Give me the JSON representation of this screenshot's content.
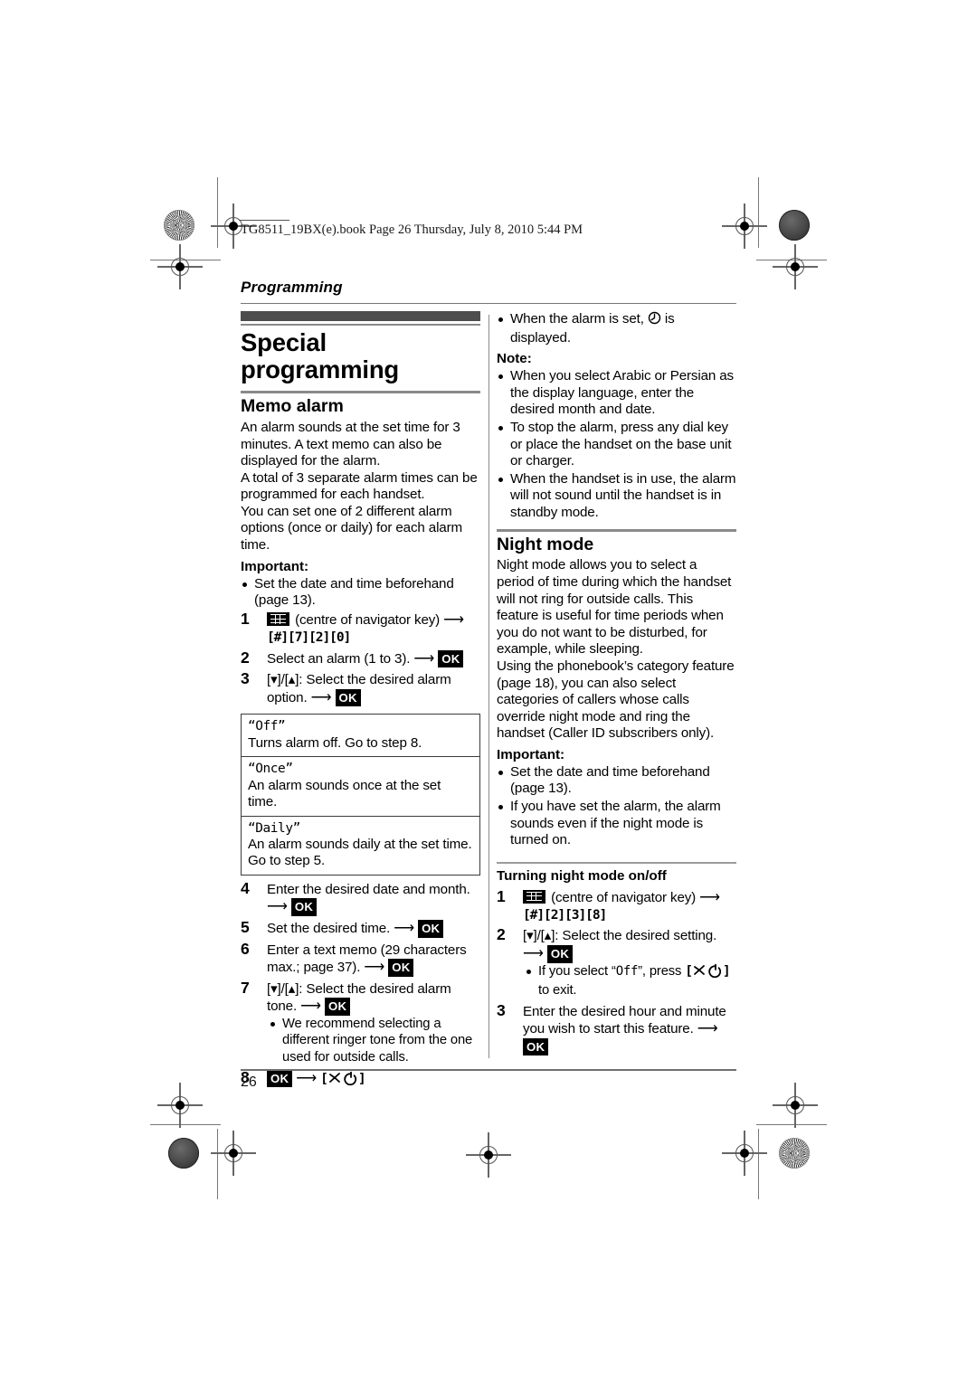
{
  "header": {
    "book_line": "TG8511_19BX(e).book  Page 26  Thursday, July 8, 2010  5:44 PM",
    "chapter": "Programming"
  },
  "footer": {
    "page_number": "26"
  },
  "left_column": {
    "title": "Special programming",
    "section": {
      "heading": "Memo alarm",
      "paragraphs": [
        "An alarm sounds at the set time for 3 minutes. A text memo can also be displayed for the alarm.",
        "A total of 3 separate alarm times can be programmed for each handset.",
        "You can set one of 2 different alarm options (once or daily) for each alarm time."
      ],
      "important_label": "Important:",
      "important_bullets": [
        "Set the date and time beforehand (page 13)."
      ],
      "steps": [
        {
          "num": "1",
          "pre": "",
          "icon": "navigator-key-icon",
          "text": "(centre of navigator key)",
          "arrow": "⟶",
          "keys": "[#][7][2][0]"
        },
        {
          "num": "2",
          "text": "Select an alarm (1 to 3).",
          "arrow": "⟶",
          "ok": "OK"
        },
        {
          "num": "3",
          "text": "[▾]/[▴]: Select the desired alarm option.",
          "arrow": "⟶",
          "ok": "OK"
        }
      ],
      "options_table": [
        {
          "name": "“Off”",
          "desc": "Turns alarm off. Go to step 8."
        },
        {
          "name": "“Once”",
          "desc": "An alarm sounds once at the set time."
        },
        {
          "name": "“Daily”",
          "desc": "An alarm sounds daily at the set time. Go to step 5."
        }
      ],
      "steps2": [
        {
          "num": "4",
          "text": "Enter the desired date and month.",
          "arrow": "⟶",
          "ok": "OK"
        },
        {
          "num": "5",
          "text": "Set the desired time.",
          "arrow": "⟶",
          "ok": "OK"
        },
        {
          "num": "6",
          "text": "Enter a text memo (29 characters max.; page 37).",
          "arrow": "⟶",
          "ok": "OK"
        },
        {
          "num": "7",
          "text": "[▾]/[▴]: Select the desired alarm tone.",
          "arrow": "⟶",
          "ok": "OK"
        },
        {
          "num": "8",
          "ok": "OK",
          "arrow": "⟶",
          "text_after": "[phone-off]"
        }
      ],
      "step7_bullet": "We recommend selecting a different ringer tone from the one used for outside calls."
    }
  },
  "right_column": {
    "top_bullets": [
      "When the alarm is set, Ⓔ is displayed."
    ],
    "note_label": "Note:",
    "note_bullets": [
      "When you select Arabic or Persian as the display language, enter the desired month and date.",
      "To stop the alarm, press any dial key or place the handset on the base unit or charger.",
      "When the handset is in use, the alarm will not sound until the handset is in standby mode."
    ],
    "section": {
      "heading": "Night mode",
      "paragraphs": [
        "Night mode allows you to select a period of time during which the handset will not ring for outside calls. This feature is useful for time periods when you do not want to be disturbed, for example, while sleeping.",
        "Using the phonebook’s category feature (page 18), you can also select categories of callers whose calls override night mode and ring the handset (Caller ID subscribers only)."
      ],
      "important_label": "Important:",
      "important_bullets": [
        "Set the date and time beforehand (page 13).",
        "If you have set the alarm, the alarm sounds even if the night mode is turned on."
      ],
      "subsection_heading": "Turning night mode on/off",
      "steps": [
        {
          "num": "1",
          "icon": "navigator-key-icon",
          "text": "(centre of navigator key)",
          "arrow": "⟶",
          "keys": "[#][2][3][8]"
        },
        {
          "num": "2",
          "text": "[▾]/[▴]: Select the desired setting.",
          "arrow": "⟶",
          "ok": "OK"
        },
        {
          "num": "3",
          "text": "Enter the desired hour and minute you wish to start this feature.",
          "arrow": "⟶",
          "ok": "OK"
        }
      ],
      "step2_bullet_pre": "If you select “",
      "step2_bullet_mono": "Off",
      "step2_bullet_post": "”, press ",
      "step2_bullet_end": " to exit."
    }
  },
  "colors": {
    "heading_bar": "#4d4d4d",
    "rule": "#8a8a8a",
    "table_border": "#3b3b3b",
    "text": "#000000"
  }
}
